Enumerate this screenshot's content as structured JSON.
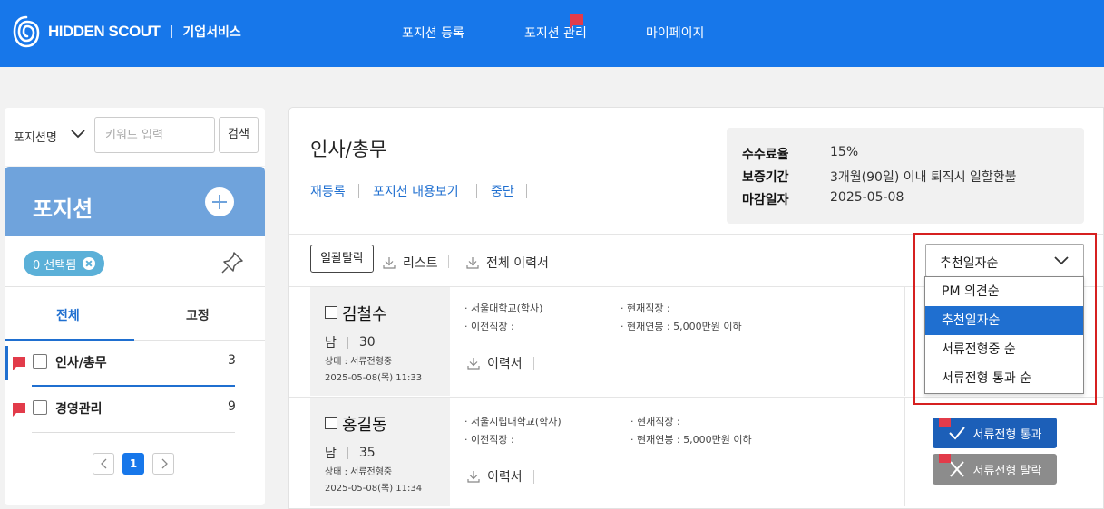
{
  "header": {
    "brand": "HIDDEN SCOUT",
    "service": "기업서비스",
    "nav": [
      "포지션 등록",
      "포지션 관리",
      "마이페이지"
    ]
  },
  "search": {
    "select_label": "포지션명",
    "placeholder": "키워드 입력",
    "button": "검색"
  },
  "positions": {
    "title": "포지션",
    "selected_chip": "0 선택됨",
    "tabs": [
      "전체",
      "고정"
    ],
    "items": [
      {
        "label": "인사/총무",
        "count": "3"
      },
      {
        "label": "경영관리",
        "count": "9"
      }
    ],
    "page": "1"
  },
  "main": {
    "title": "인사/총무",
    "actions": [
      "재등록",
      "포지션 내용보기",
      "중단"
    ],
    "info": [
      {
        "key": "수수료율",
        "value": "15%"
      },
      {
        "key": "보증기간",
        "value": "3개월(90일) 이내 퇴직시 일할환불"
      },
      {
        "key": "마감일자",
        "value": "2025-05-08"
      }
    ],
    "toolbar": {
      "bulk": "일괄탈락",
      "list": "리스트",
      "all_resume": "전체 이력서"
    },
    "candidates": [
      {
        "name": "김철수",
        "gender": "남",
        "age": "30",
        "status": "상태 : 서류전형중",
        "date": "2025-05-08(목) 11:33",
        "school": "· 서울대학교(학사)",
        "prev_job": "· 이전직장 :",
        "cur_job": "· 현재직장 :",
        "salary": "· 현재연봉 : 5,000만원 이하",
        "resume": "이력서"
      },
      {
        "name": "홍길동",
        "gender": "남",
        "age": "35",
        "status": "상태 : 서류전형중",
        "date": "2025-05-08(목) 11:34",
        "school": "· 서울시립대학교(학사)",
        "prev_job": "· 이전직장 :",
        "cur_job": "· 현재직장 :",
        "salary": "· 현재연봉 : 5,000만원 이하",
        "resume": "이력서"
      }
    ],
    "buttons": {
      "pass": "서류전형 통과",
      "fail": "서류전형 탈락"
    }
  },
  "sort": {
    "selected": "추천일자순",
    "options": [
      "PM 의견순",
      "추천일자순",
      "서류전형중 순",
      "서류전형 통과 순"
    ],
    "highlighted_index": 1
  },
  "colors": {
    "brand_blue": "#1777ea",
    "flag_red": "#e23b4a",
    "highlight": "#d62020"
  }
}
